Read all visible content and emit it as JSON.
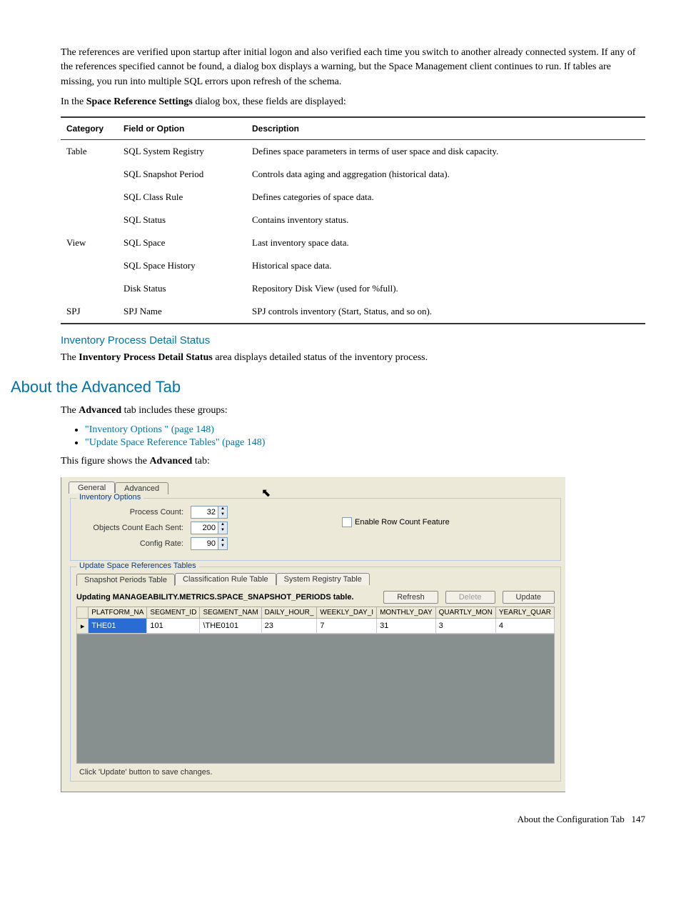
{
  "intro": {
    "p1": "The references are verified upon startup after initial logon and also verified each time you switch to another already connected system. If any of the references specified cannot be found, a dialog box displays a warning, but the Space Management client continues to run. If tables are missing, you run into multiple SQL errors upon refresh of the schema.",
    "p2_pre": "In the ",
    "p2_bold": "Space Reference Settings",
    "p2_post": " dialog box, these fields are displayed:"
  },
  "tbl": {
    "headers": {
      "c1": "Category",
      "c2": "Field or Option",
      "c3": "Description"
    },
    "rows": [
      {
        "cat": "Table",
        "field": "SQL System Registry",
        "desc": "Defines space parameters in terms of user space and disk capacity."
      },
      {
        "cat": "",
        "field": "SQL Snapshot Period",
        "desc": "Controls data aging and aggregation (historical data)."
      },
      {
        "cat": "",
        "field": "SQL Class Rule",
        "desc": "Defines categories of space data."
      },
      {
        "cat": "",
        "field": "SQL Status",
        "desc": "Contains inventory status."
      },
      {
        "cat": "View",
        "field": "SQL Space",
        "desc": "Last inventory space data."
      },
      {
        "cat": "",
        "field": "SQL Space History",
        "desc": "Historical space data."
      },
      {
        "cat": "",
        "field": "Disk Status",
        "desc": "Repository Disk View (used for %full)."
      },
      {
        "cat": "SPJ",
        "field": "SPJ Name",
        "desc": "SPJ controls inventory (Start, Status, and so on)."
      }
    ]
  },
  "ipds": {
    "heading": "Inventory Process Detail Status",
    "text_pre": "The ",
    "text_bold": "Inventory Process Detail Status",
    "text_post": " area displays detailed status of the inventory process."
  },
  "about": {
    "heading": "About the Advanced Tab",
    "lead_pre": "The ",
    "lead_bold": "Advanced",
    "lead_post": " tab includes these groups:",
    "bullets": [
      "\"Inventory Options \" (page 148)",
      "\"Update Space Reference Tables\" (page 148)"
    ],
    "fig_pre": "This figure shows the ",
    "fig_bold": "Advanced",
    "fig_post": " tab:"
  },
  "fig": {
    "tabs": {
      "general": "General",
      "advanced": "Advanced"
    },
    "inv": {
      "legend": "Inventory Options",
      "process_count_label": "Process Count:",
      "process_count_val": "32",
      "objects_label": "Objects Count Each Sent:",
      "objects_val": "200",
      "config_label": "Config Rate:",
      "config_val": "90",
      "enable_label": "Enable Row Count Feature"
    },
    "upd": {
      "legend": "Update Space References Tables",
      "sub1": "Snapshot Periods Table",
      "sub2": "Classification Rule Table",
      "sub3": "System Registry Table",
      "status": "Updating MANAGEABILITY.METRICS.SPACE_SNAPSHOT_PERIODS table.",
      "refresh": "Refresh",
      "delete": "Delete",
      "update": "Update",
      "cols": {
        "c0": "",
        "c1": "PLATFORM_NA",
        "c2": "SEGMENT_ID",
        "c3": "SEGMENT_NAM",
        "c4": "DAILY_HOUR_",
        "c5": "WEEKLY_DAY_I",
        "c6": "MONTHLY_DAY",
        "c7": "QUARTLY_MON",
        "c8": "YEARLY_QUAR"
      },
      "row": {
        "marker": "▸",
        "c1": "THE01",
        "c2": "101",
        "c3": "\\THE0101",
        "c4": "23",
        "c5": "7",
        "c6": "31",
        "c7": "3",
        "c8": "4"
      },
      "foot": "Click 'Update' button to save changes."
    }
  },
  "footer": {
    "text": "About the Configuration Tab",
    "page": "147"
  }
}
